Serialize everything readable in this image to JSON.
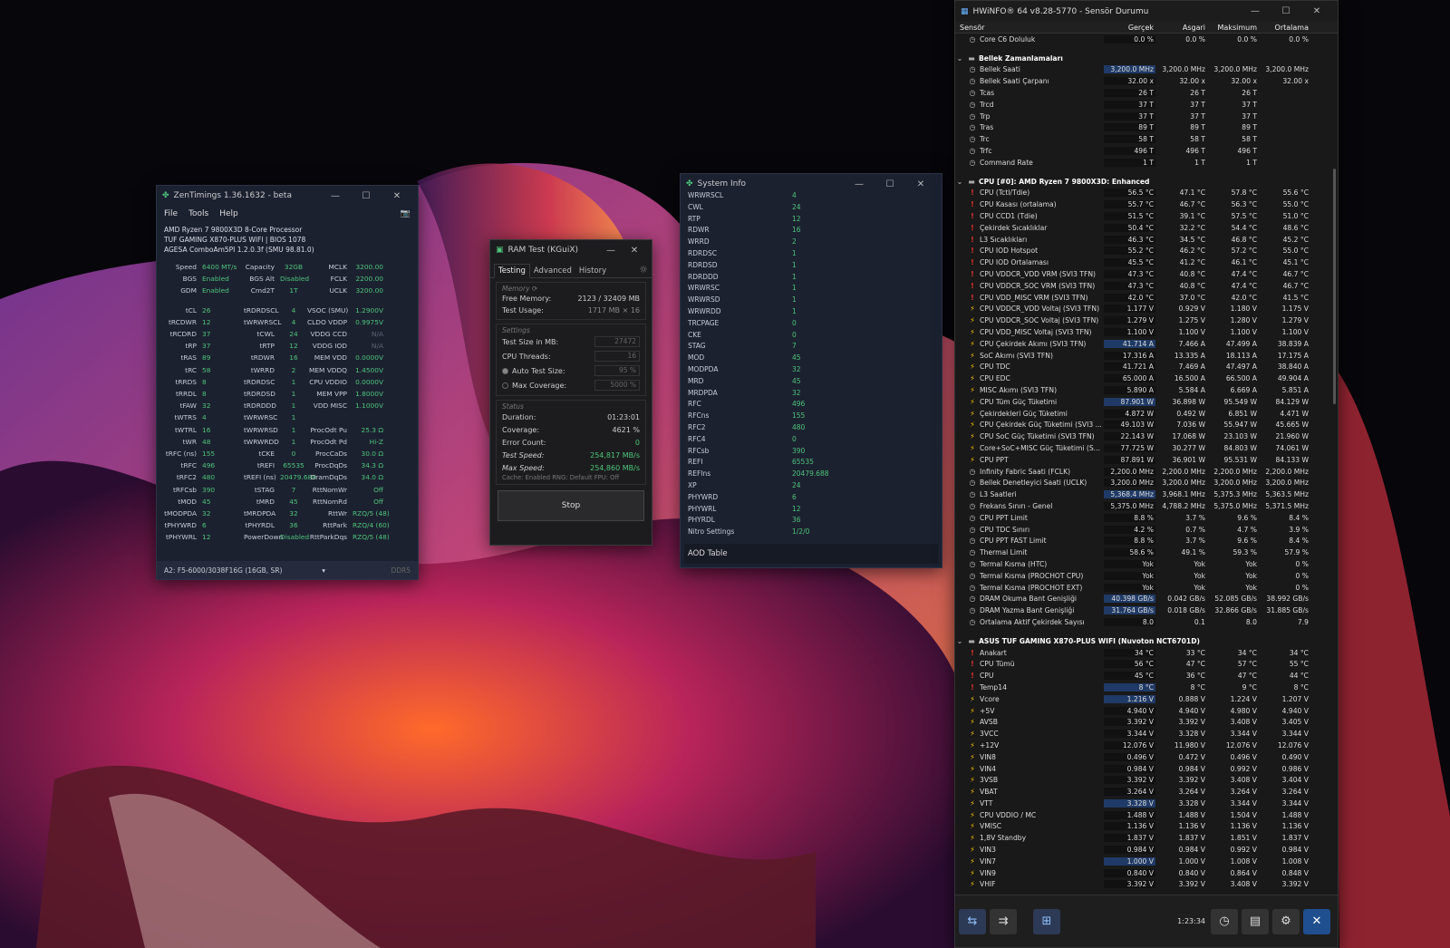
{
  "zentimings": {
    "title": "ZenTimings 1.36.1632 - beta",
    "menu": [
      "File",
      "Tools",
      "Help"
    ],
    "sysinfo": [
      "AMD Ryzen 7 9800X3D 8-Core Processor",
      "TUF GAMING X870-PLUS WIFI | BIOS 1078",
      "AGESA ComboAm5PI 1.2.0.3f (SMU 98.81.0)"
    ],
    "top_rows": [
      [
        "Speed",
        "6400 MT/s",
        "Capacity",
        "32GB",
        "MCLK",
        "3200.00"
      ],
      [
        "BGS",
        "Enabled",
        "BGS Alt",
        "Disabled",
        "FCLK",
        "2200.00"
      ],
      [
        "GDM",
        "Enabled",
        "Cmd2T",
        "1T",
        "UCLK",
        "3200.00"
      ]
    ],
    "timing_rows": [
      [
        "tCL",
        "26",
        "tRDRDSCL",
        "4",
        "VSOC (SMU)",
        "1.2900V"
      ],
      [
        "tRCDWR",
        "12",
        "tWRWRSCL",
        "4",
        "CLDO VDDP",
        "0.9975V"
      ],
      [
        "tRCDRD",
        "37",
        "tCWL",
        "24",
        "VDDG CCD",
        "N/A"
      ],
      [
        "tRP",
        "37",
        "tRTP",
        "12",
        "VDDG IOD",
        "N/A"
      ],
      [
        "tRAS",
        "89",
        "tRDWR",
        "16",
        "MEM VDD",
        "0.0000V"
      ],
      [
        "tRC",
        "58",
        "tWRRD",
        "2",
        "MEM VDDQ",
        "1.4500V"
      ],
      [
        "tRRDS",
        "8",
        "tRDRDSC",
        "1",
        "CPU VDDIO",
        "0.0000V"
      ],
      [
        "tRRDL",
        "8",
        "tRDRDSD",
        "1",
        "MEM VPP",
        "1.8000V"
      ],
      [
        "tFAW",
        "32",
        "tRDRDDD",
        "1",
        "VDD MISC",
        "1.1000V"
      ],
      [
        "tWTRS",
        "4",
        "tWRWRSC",
        "1",
        "",
        ""
      ],
      [
        "tWTRL",
        "16",
        "tWRWRSD",
        "1",
        "ProcOdt Pu",
        "25.3 Ω"
      ],
      [
        "tWR",
        "48",
        "tWRWRDD",
        "1",
        "ProcOdt Pd",
        "Hi-Z"
      ],
      [
        "tRFC (ns)",
        "155",
        "tCKE",
        "0",
        "ProcCaDs",
        "30.0 Ω"
      ],
      [
        "tRFC",
        "496",
        "tREFI",
        "65535",
        "ProcDqDs",
        "34.3 Ω"
      ],
      [
        "tRFC2",
        "480",
        "tREFI (ns)",
        "20479.688",
        "DramDqDs",
        "34.0 Ω"
      ],
      [
        "tRFCsb",
        "390",
        "tSTAG",
        "7",
        "RttNomWr",
        "Off"
      ],
      [
        "tMOD",
        "45",
        "tMRD",
        "45",
        "RttNomRd",
        "Off"
      ],
      [
        "tMODPDA",
        "32",
        "tMRDPDA",
        "32",
        "RttWr",
        "RZQ/5 (48)"
      ],
      [
        "tPHYWRD",
        "6",
        "tPHYRDL",
        "36",
        "RttPark",
        "RZQ/4 (60)"
      ],
      [
        "tPHYWRL",
        "12",
        "PowerDown",
        "Disabled",
        "RttParkDqs",
        "RZQ/5 (48)"
      ]
    ],
    "dim_values": [
      "N/A"
    ],
    "footer_select": "A2: F5-6000/3038F16G (16GB, SR)",
    "footer_type": "DDR5"
  },
  "sysinfo_win": {
    "title": "System Info",
    "rows": [
      [
        "WRWRSCL",
        "4"
      ],
      [
        "CWL",
        "24"
      ],
      [
        "RTP",
        "12"
      ],
      [
        "RDWR",
        "16"
      ],
      [
        "WRRD",
        "2"
      ],
      [
        "RDRDSC",
        "1"
      ],
      [
        "RDRDSD",
        "1"
      ],
      [
        "RDRDDD",
        "1"
      ],
      [
        "WRWRSC",
        "1"
      ],
      [
        "WRWRSD",
        "1"
      ],
      [
        "WRWRDD",
        "1"
      ],
      [
        "TRCPAGE",
        "0"
      ],
      [
        "CKE",
        "0"
      ],
      [
        "STAG",
        "7"
      ],
      [
        "MOD",
        "45"
      ],
      [
        "MODPDA",
        "32"
      ],
      [
        "MRD",
        "45"
      ],
      [
        "MRDPDA",
        "32"
      ],
      [
        "RFC",
        "496"
      ],
      [
        "RFCns",
        "155"
      ],
      [
        "RFC2",
        "480"
      ],
      [
        "RFC4",
        "0"
      ],
      [
        "RFCsb",
        "390"
      ],
      [
        "REFI",
        "65535"
      ],
      [
        "REFIns",
        "20479.688"
      ],
      [
        "XP",
        "24"
      ],
      [
        "PHYWRD",
        "6"
      ],
      [
        "PHYWRL",
        "12"
      ],
      [
        "PHYRDL",
        "36"
      ],
      [
        "Nitro Settings",
        "1/2/0"
      ]
    ],
    "aod": "AOD Table"
  },
  "ramtest": {
    "title": "RAM Test (KGuiX)",
    "tabs": [
      "Testing",
      "Advanced",
      "History"
    ],
    "memory_h": "Memory",
    "free_label": "Free Memory:",
    "free_value": "2123 / 32409 MB",
    "usage_label": "Test Usage:",
    "usage_value": "1717 MB × 16",
    "settings_h": "Settings",
    "size_label": "Test Size in MB:",
    "size_value": "27472",
    "threads_label": "CPU Threads:",
    "threads_value": "16",
    "auto_label": "Auto Test Size:",
    "auto_value": "95 %",
    "cov_label": "Max Coverage:",
    "cov_value": "5000 %",
    "status_h": "Status",
    "dur_label": "Duration:",
    "dur_value": "01:23:01",
    "covs_label": "Coverage:",
    "covs_value": "4621 %",
    "err_label": "Error Count:",
    "err_value": "0",
    "ts_label": "Test Speed:",
    "ts_value": "254,817 MB/s",
    "ms_label": "Max Speed:",
    "ms_value": "254,860 MB/s",
    "cache_line": "Cache: Enabled  RNG: Default  FPU: Off",
    "stop": "Stop"
  },
  "hwinfo": {
    "title": "HWiNFO® 64 v8.28-5770 - Sensör Durumu",
    "headers": [
      "Sensör",
      "Gerçek",
      "Asgari",
      "Maksimum",
      "Ortalama"
    ],
    "rows": [
      [
        "s",
        "Core C6 Doluluk",
        "0.0 %",
        "0.0 %",
        "0.0 %",
        "0.0 %",
        "clk"
      ],
      [
        "b"
      ],
      [
        "g",
        "Bellek Zamanlamaları"
      ],
      [
        "s",
        "Bellek Saati",
        "3,200.0 MHz",
        "3,200.0 MHz",
        "3,200.0 MHz",
        "3,200.0 MHz",
        "clk"
      ],
      [
        "s",
        "Bellek Saati Çarpanı",
        "32.00 x",
        "32.00 x",
        "32.00 x",
        "32.00 x",
        "clk"
      ],
      [
        "s",
        "Tcas",
        "26 T",
        "26 T",
        "26 T",
        "",
        "clk"
      ],
      [
        "s",
        "Trcd",
        "37 T",
        "37 T",
        "37 T",
        "",
        "clk"
      ],
      [
        "s",
        "Trp",
        "37 T",
        "37 T",
        "37 T",
        "",
        "clk"
      ],
      [
        "s",
        "Tras",
        "89 T",
        "89 T",
        "89 T",
        "",
        "clk"
      ],
      [
        "s",
        "Trc",
        "58 T",
        "58 T",
        "58 T",
        "",
        "clk"
      ],
      [
        "s",
        "Trfc",
        "496 T",
        "496 T",
        "496 T",
        "",
        "clk"
      ],
      [
        "s",
        "Command Rate",
        "1 T",
        "1 T",
        "1 T",
        "",
        "clk"
      ],
      [
        "b"
      ],
      [
        "g",
        "CPU [#0]: AMD Ryzen 7 9800X3D: Enhanced"
      ],
      [
        "s",
        "CPU (Tctl/Tdie)",
        "56.5 °C",
        "47.1 °C",
        "57.8 °C",
        "55.6 °C",
        "tmp"
      ],
      [
        "s",
        "CPU Kasası (ortalama)",
        "55.7 °C",
        "46.7 °C",
        "56.3 °C",
        "55.0 °C",
        "tmp"
      ],
      [
        "s",
        "CPU CCD1 (Tdie)",
        "51.5 °C",
        "39.1 °C",
        "57.5 °C",
        "51.0 °C",
        "tmp"
      ],
      [
        "s",
        "Çekirdek Sıcaklıklar",
        "50.4 °C",
        "32.2 °C",
        "54.4 °C",
        "48.6 °C",
        "tmp"
      ],
      [
        "s",
        "L3 Sıcaklıkları",
        "46.3 °C",
        "34.5 °C",
        "46.8 °C",
        "45.2 °C",
        "tmp"
      ],
      [
        "s",
        "CPU IOD Hotspot",
        "55.2 °C",
        "46.2 °C",
        "57.2 °C",
        "55.0 °C",
        "tmp"
      ],
      [
        "s",
        "CPU IOD Ortalaması",
        "45.5 °C",
        "41.2 °C",
        "46.1 °C",
        "45.1 °C",
        "tmp"
      ],
      [
        "s",
        "CPU VDDCR_VDD VRM (SVI3 TFN)",
        "47.3 °C",
        "40.8 °C",
        "47.4 °C",
        "46.7 °C",
        "tmp"
      ],
      [
        "s",
        "CPU VDDCR_SOC VRM (SVI3 TFN)",
        "47.3 °C",
        "40.8 °C",
        "47.4 °C",
        "46.7 °C",
        "tmp"
      ],
      [
        "s",
        "CPU VDD_MISC VRM (SVI3 TFN)",
        "42.0 °C",
        "37.0 °C",
        "42.0 °C",
        "41.5 °C",
        "tmp"
      ],
      [
        "s",
        "CPU VDDCR_VDD Voltaj (SVI3 TFN)",
        "1.177 V",
        "0.929 V",
        "1.180 V",
        "1.175 V",
        "vlt"
      ],
      [
        "s",
        "CPU VDDCR_SOC Voltaj (SVI3 TFN)",
        "1.279 V",
        "1.275 V",
        "1.280 V",
        "1.279 V",
        "vlt"
      ],
      [
        "s",
        "CPU VDD_MISC Voltaj (SVI3 TFN)",
        "1.100 V",
        "1.100 V",
        "1.100 V",
        "1.100 V",
        "vlt"
      ],
      [
        "s",
        "CPU Çekirdek Akımı (SVI3 TFN)",
        "41.714 A",
        "7.466 A",
        "47.499 A",
        "38.839 A",
        "vlt"
      ],
      [
        "s",
        "SoC Akımı (SVI3 TFN)",
        "17.316 A",
        "13.335 A",
        "18.113 A",
        "17.175 A",
        "vlt"
      ],
      [
        "s",
        "CPU TDC",
        "41.721 A",
        "7.469 A",
        "47.497 A",
        "38.840 A",
        "vlt"
      ],
      [
        "s",
        "CPU EDC",
        "65.000 A",
        "16.500 A",
        "66.500 A",
        "49.904 A",
        "vlt"
      ],
      [
        "s",
        "MISC Akımı (SVI3 TFN)",
        "5.890 A",
        "5.584 A",
        "6.669 A",
        "5.851 A",
        "vlt"
      ],
      [
        "s",
        "CPU Tüm Güç Tüketimi",
        "87.901 W",
        "36.898 W",
        "95.549 W",
        "84.129 W",
        "vlt"
      ],
      [
        "s",
        "Çekirdekleri Güç Tüketimi",
        "4.872 W",
        "0.492 W",
        "6.851 W",
        "4.471 W",
        "vlt"
      ],
      [
        "s",
        "CPU Çekirdek Güç Tüketimi (SVI3 ...",
        "49.103 W",
        "7.036 W",
        "55.947 W",
        "45.665 W",
        "vlt"
      ],
      [
        "s",
        "CPU SoC Güç Tüketimi (SVI3 TFN)",
        "22.143 W",
        "17.068 W",
        "23.103 W",
        "21.960 W",
        "vlt"
      ],
      [
        "s",
        "Core+SoC+MISC Güç Tüketimi (S...",
        "77.725 W",
        "30.277 W",
        "84.803 W",
        "74.061 W",
        "vlt"
      ],
      [
        "s",
        "CPU PPT",
        "87.891 W",
        "36.901 W",
        "95.531 W",
        "84.133 W",
        "vlt"
      ],
      [
        "s",
        "Infinity Fabric Saati (FCLK)",
        "2,200.0 MHz",
        "2,200.0 MHz",
        "2,200.0 MHz",
        "2,200.0 MHz",
        "clk"
      ],
      [
        "s",
        "Bellek Denetleyici Saati (UCLK)",
        "3,200.0 MHz",
        "3,200.0 MHz",
        "3,200.0 MHz",
        "3,200.0 MHz",
        "clk"
      ],
      [
        "s",
        "L3 Saatleri",
        "5,368.4 MHz",
        "3,968.1 MHz",
        "5,375.3 MHz",
        "5,363.5 MHz",
        "clk"
      ],
      [
        "s",
        "Frekans Sınırı - Genel",
        "5,375.0 MHz",
        "4,788.2 MHz",
        "5,375.0 MHz",
        "5,371.5 MHz",
        "clk"
      ],
      [
        "s",
        "CPU PPT Limit",
        "8.8 %",
        "3.7 %",
        "9.6 %",
        "8.4 %",
        "clk"
      ],
      [
        "s",
        "CPU TDC Sınırı",
        "4.2 %",
        "0.7 %",
        "4.7 %",
        "3.9 %",
        "clk"
      ],
      [
        "s",
        "CPU PPT FAST Limit",
        "8.8 %",
        "3.7 %",
        "9.6 %",
        "8.4 %",
        "clk"
      ],
      [
        "s",
        "Thermal Limit",
        "58.6 %",
        "49.1 %",
        "59.3 %",
        "57.9 %",
        "clk"
      ],
      [
        "s",
        "Termal Kısma (HTC)",
        "Yok",
        "Yok",
        "Yok",
        "0 %",
        "clk"
      ],
      [
        "s",
        "Termal Kısma (PROCHOT CPU)",
        "Yok",
        "Yok",
        "Yok",
        "0 %",
        "clk"
      ],
      [
        "s",
        "Termal Kısma (PROCHOT EXT)",
        "Yok",
        "Yok",
        "Yok",
        "0 %",
        "clk"
      ],
      [
        "s",
        "DRAM Okuma Bant Genişliği",
        "40.398 GB/s",
        "0.042 GB/s",
        "52.085 GB/s",
        "38.992 GB/s",
        "clk"
      ],
      [
        "s",
        "DRAM Yazma Bant Genişliği",
        "31.764 GB/s",
        "0.018 GB/s",
        "32.866 GB/s",
        "31.885 GB/s",
        "clk"
      ],
      [
        "s",
        "Ortalama Aktif Çekirdek Sayısı",
        "8.0",
        "0.1",
        "8.0",
        "7.9",
        "clk"
      ],
      [
        "b"
      ],
      [
        "g",
        "ASUS TUF GAMING X870-PLUS WIFI (Nuvoton NCT6701D)"
      ],
      [
        "s",
        "Anakart",
        "34 °C",
        "33 °C",
        "34 °C",
        "34 °C",
        "tmp"
      ],
      [
        "s",
        "CPU Tümü",
        "56 °C",
        "47 °C",
        "57 °C",
        "55 °C",
        "tmp"
      ],
      [
        "s",
        "CPU",
        "45 °C",
        "36 °C",
        "47 °C",
        "44 °C",
        "tmp"
      ],
      [
        "s",
        "Temp14",
        "8 °C",
        "8 °C",
        "9 °C",
        "8 °C",
        "tmp"
      ],
      [
        "s",
        "Vcore",
        "1.216 V",
        "0.888 V",
        "1.224 V",
        "1.207 V",
        "vlt"
      ],
      [
        "s",
        "+5V",
        "4.940 V",
        "4.940 V",
        "4.980 V",
        "4.940 V",
        "vlt"
      ],
      [
        "s",
        "AVSB",
        "3.392 V",
        "3.392 V",
        "3.408 V",
        "3.405 V",
        "vlt"
      ],
      [
        "s",
        "3VCC",
        "3.344 V",
        "3.328 V",
        "3.344 V",
        "3.344 V",
        "vlt"
      ],
      [
        "s",
        "+12V",
        "12.076 V",
        "11.980 V",
        "12.076 V",
        "12.076 V",
        "vlt"
      ],
      [
        "s",
        "VIN8",
        "0.496 V",
        "0.472 V",
        "0.496 V",
        "0.490 V",
        "vlt"
      ],
      [
        "s",
        "VIN4",
        "0.984 V",
        "0.984 V",
        "0.992 V",
        "0.986 V",
        "vlt"
      ],
      [
        "s",
        "3VSB",
        "3.392 V",
        "3.392 V",
        "3.408 V",
        "3.404 V",
        "vlt"
      ],
      [
        "s",
        "VBAT",
        "3.264 V",
        "3.264 V",
        "3.264 V",
        "3.264 V",
        "vlt"
      ],
      [
        "s",
        "VTT",
        "3.328 V",
        "3.328 V",
        "3.344 V",
        "3.344 V",
        "vlt"
      ],
      [
        "s",
        "CPU VDDIO / MC",
        "1.488 V",
        "1.488 V",
        "1.504 V",
        "1.488 V",
        "vlt"
      ],
      [
        "s",
        "VMISC",
        "1.136 V",
        "1.136 V",
        "1.136 V",
        "1.136 V",
        "vlt"
      ],
      [
        "s",
        "1,8V Standby",
        "1.837 V",
        "1.837 V",
        "1.851 V",
        "1.837 V",
        "vlt"
      ],
      [
        "s",
        "VIN3",
        "0.984 V",
        "0.984 V",
        "0.992 V",
        "0.984 V",
        "vlt"
      ],
      [
        "s",
        "VIN7",
        "1.000 V",
        "1.000 V",
        "1.008 V",
        "1.008 V",
        "vlt"
      ],
      [
        "s",
        "VIN9",
        "0.840 V",
        "0.840 V",
        "0.864 V",
        "0.848 V",
        "vlt"
      ],
      [
        "s",
        "VHIF",
        "3.392 V",
        "3.392 V",
        "3.408 V",
        "3.392 V",
        "vlt"
      ]
    ],
    "highlight_rows": [
      "Bellek Saati",
      "L3 Saatleri",
      "Temp14",
      "Vcore",
      "VTT",
      "VIN7",
      "CPU Tüm Güç Tüketimi",
      "CPU Çekirdek Akımı (SVI3 TFN)",
      "DRAM Okuma Bant Genişliği",
      "DRAM Yazma Bant Genişliği"
    ],
    "time": "1:23:34"
  }
}
